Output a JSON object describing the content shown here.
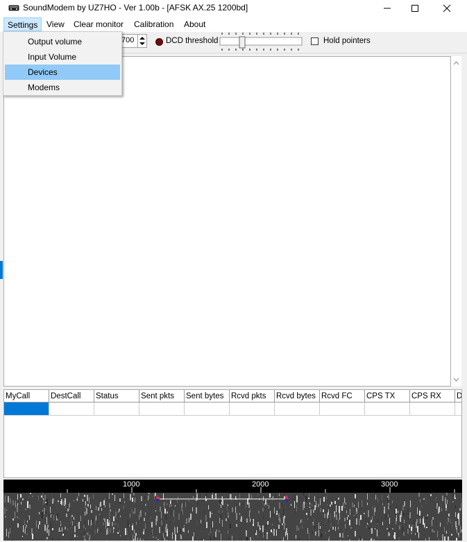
{
  "window": {
    "title": "SoundModem by UZ7HO - Ver 1.00b - [AFSK AX.25 1200bd]",
    "icons": [
      "modem-icon",
      "minimize-icon",
      "maximize-icon",
      "close-icon"
    ]
  },
  "menu": {
    "items": [
      "Settings",
      "View",
      "Clear monitor",
      "Calibration",
      "About"
    ],
    "active": "Settings"
  },
  "settings_menu": {
    "items": [
      "Output volume",
      "Input Volume",
      "Devices",
      "Modems"
    ],
    "highlighted": "Devices"
  },
  "toolbar": {
    "spin_value": "700",
    "dcd_label": "DCD threshold",
    "hold_label": "Hold pointers",
    "hold_checked": false
  },
  "table": {
    "columns": [
      "MyCall",
      "DestCall",
      "Status",
      "Sent pkts",
      "Sent bytes",
      "Rcvd pkts",
      "Rcvd bytes",
      "Rcvd FC",
      "CPS TX",
      "CPS RX",
      "D"
    ]
  },
  "spectrum": {
    "ruler_labels": [
      "1000",
      "2000",
      "3000"
    ],
    "marker_low_hz": 1200,
    "marker_high_hz": 2200
  },
  "colors": {
    "selection": "#0078d7",
    "menu_highlight": "#91c9f7",
    "dcd_led": "#6e0d0d"
  }
}
